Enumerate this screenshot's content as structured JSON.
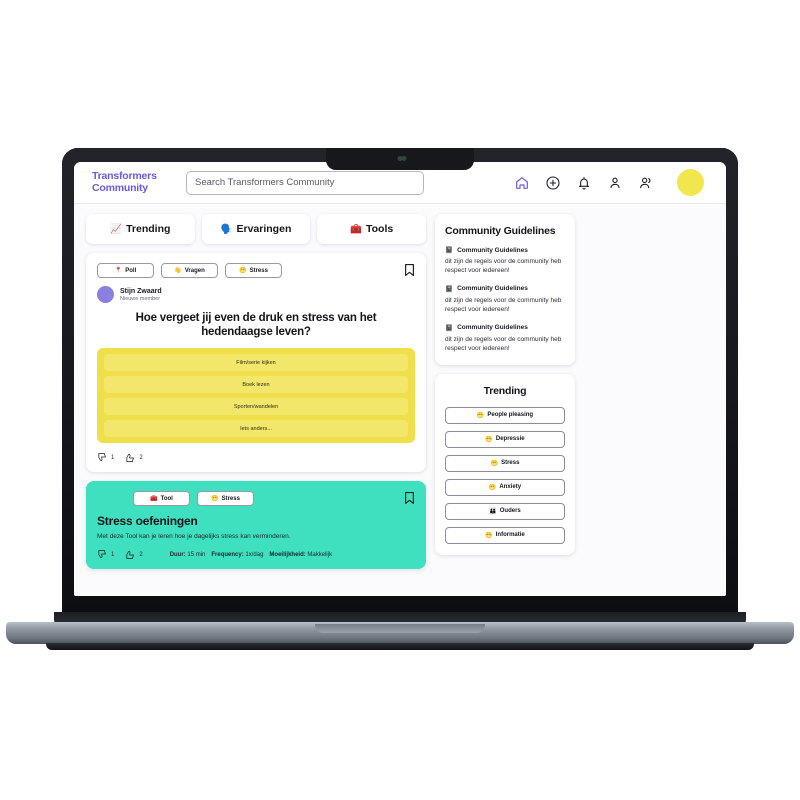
{
  "app": {
    "brand": "Transformers\nCommunity",
    "brand_color": "#6f56e8"
  },
  "search": {
    "placeholder": "Search Transformers Community",
    "value": ""
  },
  "nav": {
    "icons": [
      {
        "name": "home-icon",
        "active": true
      },
      {
        "name": "plus-circle-icon",
        "active": false
      },
      {
        "name": "bell-icon",
        "active": false
      },
      {
        "name": "person-icon",
        "active": false
      },
      {
        "name": "people-icon",
        "active": false
      }
    ],
    "avatar_color": "#f2e64e"
  },
  "tabs": [
    {
      "label": "Trending",
      "emoji": "📈"
    },
    {
      "label": "Ervaringen",
      "emoji": "🗣️"
    },
    {
      "label": "Tools",
      "emoji": "🧰"
    }
  ],
  "feed": {
    "poll_post": {
      "tags": [
        {
          "label": "Poll",
          "emoji": "📍"
        },
        {
          "label": "Vragen",
          "emoji": "👋"
        },
        {
          "label": "Stress",
          "emoji": "😁"
        }
      ],
      "author_name": "Stijn Zwaard",
      "author_sub": "Nieuwe member",
      "author_avatar_color": "#8b7fe0",
      "title": "Hoe vergeet jij even de druk en stress van het hedendaagse leven?",
      "poll_options": [
        "Film/serie kijken",
        "Boek lezen",
        "Sporten/wandelen",
        "Iets anders..."
      ],
      "poll_bg": "#efe04b",
      "downvotes": "1",
      "upvotes": "2"
    },
    "tool_post": {
      "card_color": "#3fe0c0",
      "tags": [
        {
          "label": "Tool",
          "emoji": "🧰"
        },
        {
          "label": "Stress",
          "emoji": "😁"
        }
      ],
      "title": "Stress oefeningen",
      "description": "Met deze Tool kan je leren hoe je dagelijks stress kan verminderen.",
      "downvotes": "1",
      "upvotes": "2",
      "meta": [
        {
          "key": "Duur:",
          "value": "15 min"
        },
        {
          "key": "Frequency:",
          "value": "1x/dag"
        },
        {
          "key": "Moeilijkheid:",
          "value": "Makkelijk"
        }
      ]
    }
  },
  "rail": {
    "guidelines_title": "Community Guidelines",
    "guidelines": [
      {
        "emoji": "📓",
        "heading": "Community Guidelines",
        "body": "dit zijn de regels voor de community heb respect voor iedereen!"
      },
      {
        "emoji": "📓",
        "heading": "Community Guidelines",
        "body": "dit zijn de regels voor de community heb respect voor iedereen!"
      },
      {
        "emoji": "📓",
        "heading": "Community Guidelines",
        "body": "dit zijn de regels voor de community heb respect voor iedereen!"
      }
    ],
    "trending_title": "Trending",
    "trending": [
      {
        "label": "People pleasing",
        "emoji": "😁"
      },
      {
        "label": "Depressie",
        "emoji": "😁"
      },
      {
        "label": "Stress",
        "emoji": "😁"
      },
      {
        "label": "Anxiety",
        "emoji": "😁"
      },
      {
        "label": "Ouders",
        "emoji": "👪"
      },
      {
        "label": "Informatie",
        "emoji": "😁"
      }
    ]
  }
}
